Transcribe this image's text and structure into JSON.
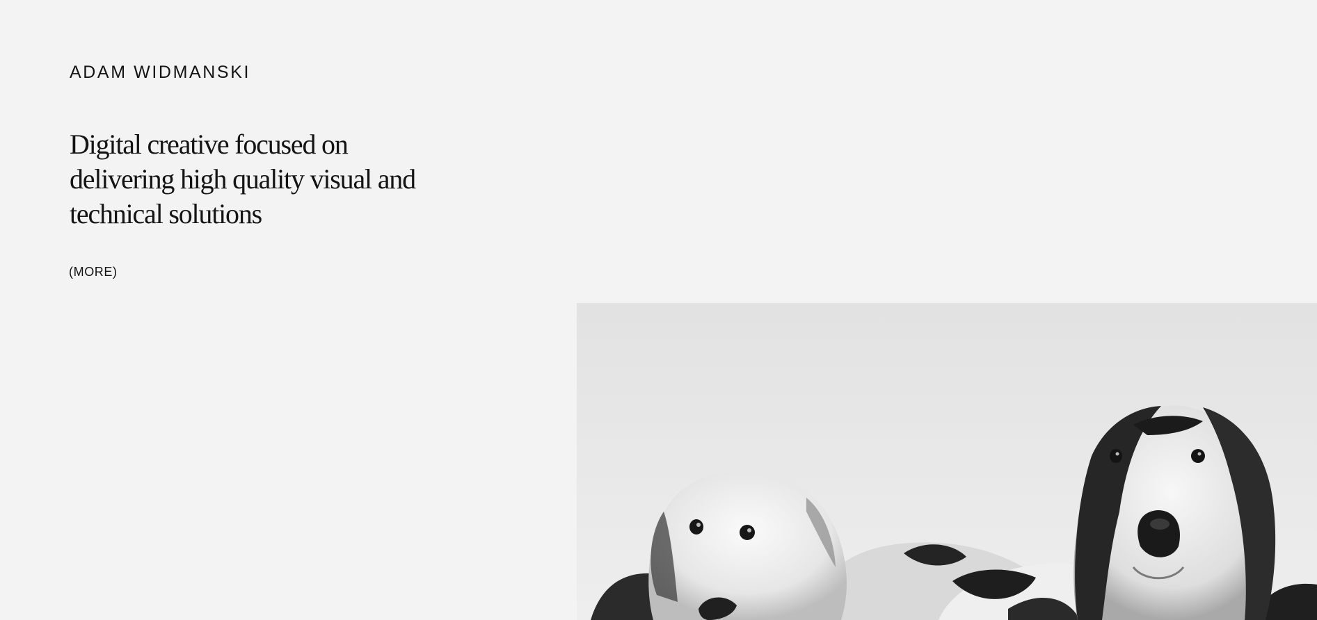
{
  "header": {
    "logo_text": "ADAM WIDMANSKI"
  },
  "intro": {
    "tagline": "Digital creative focused on delivering high quality visual and technical solutions",
    "more_label": "(MORE)"
  },
  "hero_image": {
    "subject": "black-and-white photo of two borzoi dogs"
  },
  "colors": {
    "background": "#f3f3f3",
    "text": "#141414",
    "photo_background": "#e4e4e4"
  }
}
